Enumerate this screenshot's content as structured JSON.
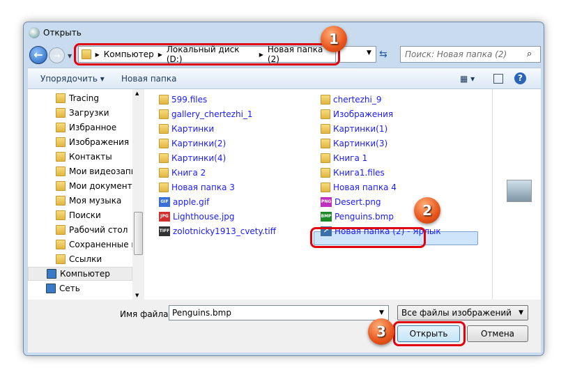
{
  "window": {
    "title": "Открыть"
  },
  "address": {
    "crumbs": [
      "Компьютер",
      "Локальный диск (D:)",
      "Новая папка (2)"
    ]
  },
  "search": {
    "placeholder": "Поиск: Новая папка (2)"
  },
  "toolbar": {
    "organize": "Упорядочить",
    "new_folder": "Новая папка"
  },
  "tree": [
    {
      "label": "Tracing"
    },
    {
      "label": "Загрузки"
    },
    {
      "label": "Избранное"
    },
    {
      "label": "Изображения"
    },
    {
      "label": "Контакты"
    },
    {
      "label": "Мои видеозапис"
    },
    {
      "label": "Мои документы"
    },
    {
      "label": "Моя музыка"
    },
    {
      "label": "Поиски"
    },
    {
      "label": "Рабочий стол"
    },
    {
      "label": "Сохраненные иг"
    },
    {
      "label": "Ссылки"
    },
    {
      "label": "Компьютер",
      "selected": true
    },
    {
      "label": "Сеть"
    }
  ],
  "files_col1": [
    {
      "name": "599.files",
      "type": "folder"
    },
    {
      "name": "gallery_chertezhi_1",
      "type": "folder"
    },
    {
      "name": "Картинки",
      "type": "folder"
    },
    {
      "name": "Картинки(2)",
      "type": "folder"
    },
    {
      "name": "Картинки(4)",
      "type": "folder"
    },
    {
      "name": "Книга 2",
      "type": "folder"
    },
    {
      "name": "Новая папка 3",
      "type": "folder"
    },
    {
      "name": "apple.gif",
      "type": "GIF"
    },
    {
      "name": "Lighthouse.jpg",
      "type": "JPG"
    },
    {
      "name": "zolotnicky1913_cvety.tiff",
      "type": "TIFF"
    }
  ],
  "files_col2": [
    {
      "name": "chertezhi_9",
      "type": "folder"
    },
    {
      "name": "Изображения",
      "type": "folder"
    },
    {
      "name": "Картинки(1)",
      "type": "folder"
    },
    {
      "name": "Картинки(3)",
      "type": "folder"
    },
    {
      "name": "Книга 1",
      "type": "folder"
    },
    {
      "name": "Книга1.files",
      "type": "folder"
    },
    {
      "name": "Новая папка 4",
      "type": "folder"
    },
    {
      "name": "Desert.png",
      "type": "PNG"
    },
    {
      "name": "Penguins.bmp",
      "type": "BMP",
      "selected": true
    },
    {
      "name": "Новая папка (2) - Ярлык",
      "type": "shortcut"
    }
  ],
  "bottom": {
    "filename_label": "Имя файла:",
    "filename_value": "Penguins.bmp",
    "filetype": "Все файлы изображений",
    "open": "Открыть",
    "cancel": "Отмена"
  },
  "badges": [
    "1",
    "2",
    "3"
  ],
  "colors": {
    "highlight": "#e0000e",
    "badge": "#e8541a",
    "link": "#1a1aff"
  }
}
